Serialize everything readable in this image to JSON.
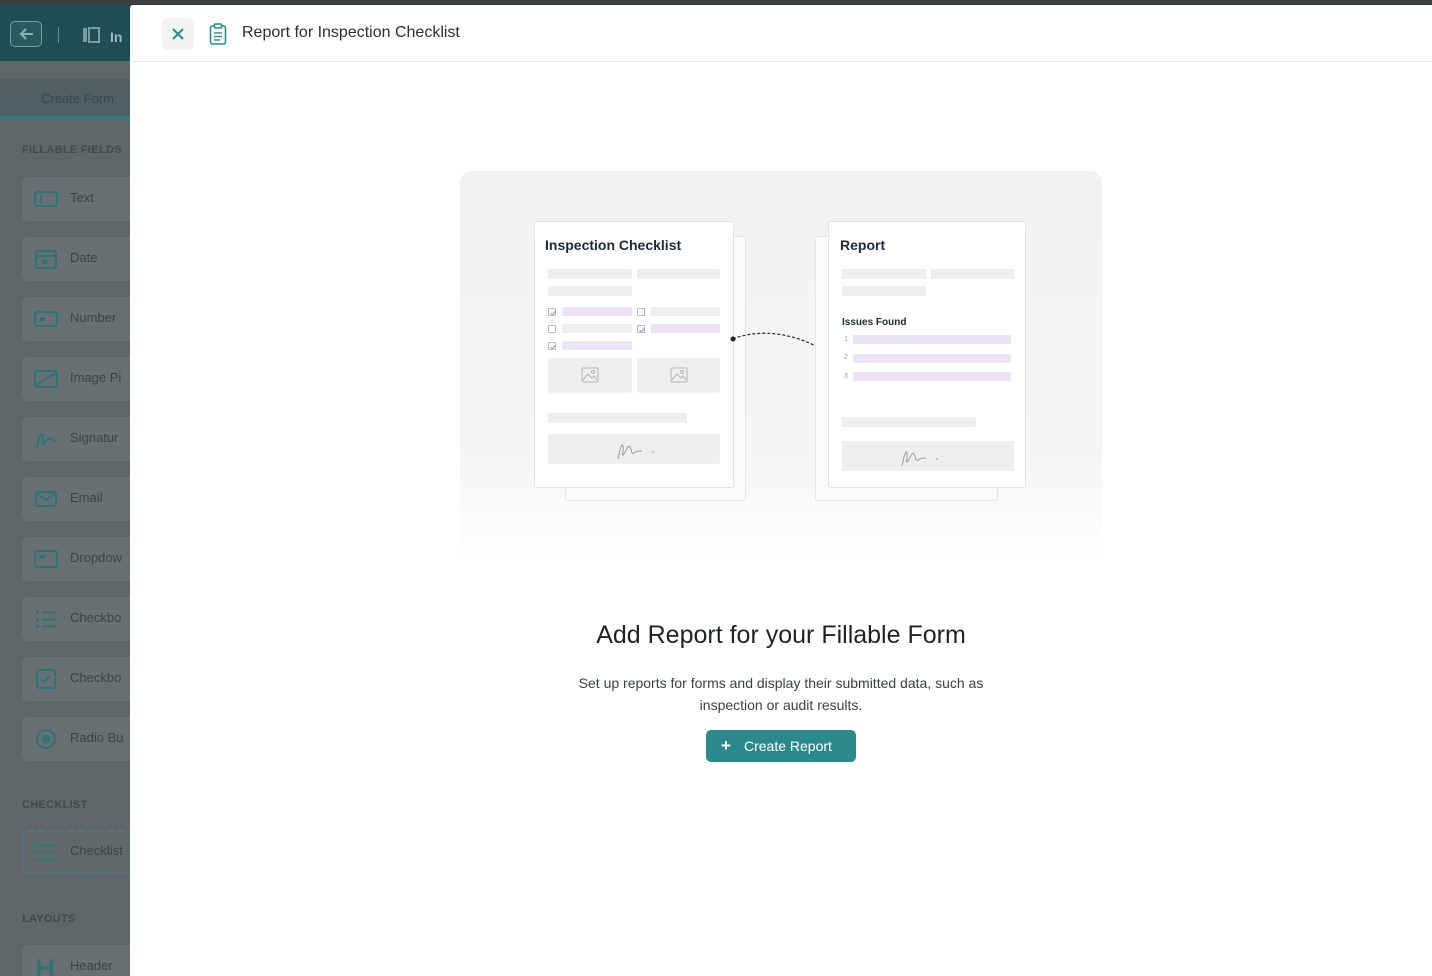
{
  "colors": {
    "accent": "#2a8a8b",
    "overlay": "#5a6468",
    "illustration_purple": "#ebe3f5"
  },
  "app": {
    "title": "In",
    "tab_label": "Create Form",
    "sections": {
      "fillable": "FILLABLE FIELDS",
      "checklist": "CHECKLIST",
      "layouts": "LAYOUTS"
    },
    "fields": [
      {
        "label": "Text",
        "icon": "text-field-icon"
      },
      {
        "label": "Date",
        "icon": "calendar-icon"
      },
      {
        "label": "Number",
        "icon": "number-field-icon"
      },
      {
        "label": "Image Pi",
        "icon": "image-icon"
      },
      {
        "label": "Signatur",
        "icon": "signature-icon"
      },
      {
        "label": "Email",
        "icon": "mail-icon"
      },
      {
        "label": "Dropdow",
        "icon": "dropdown-icon"
      },
      {
        "label": "Checkbo",
        "icon": "checkbox-list-icon"
      },
      {
        "label": "Checkbo",
        "icon": "checkbox-icon"
      },
      {
        "label": "Radio Bu",
        "icon": "radio-icon"
      }
    ],
    "checklist_item": {
      "label": "Checklist",
      "icon": "checklist-icon"
    },
    "layout_item": {
      "label": "Header",
      "icon": "header-icon"
    }
  },
  "modal": {
    "title": "Report for Inspection Checklist",
    "close_icon": "close-icon",
    "title_icon": "clipboard-icon",
    "illustration": {
      "left_doc_title": "Inspection Checklist",
      "right_doc_title": "Report",
      "issues_label": "Issues Found",
      "issue_numbers": [
        "1",
        "2",
        "3"
      ]
    },
    "heading": "Add Report for your Fillable Form",
    "description": "Set up reports for forms and display their submitted data, such as inspection or audit results.",
    "create_button": {
      "icon": "plus-icon",
      "label": "Create Report"
    }
  }
}
